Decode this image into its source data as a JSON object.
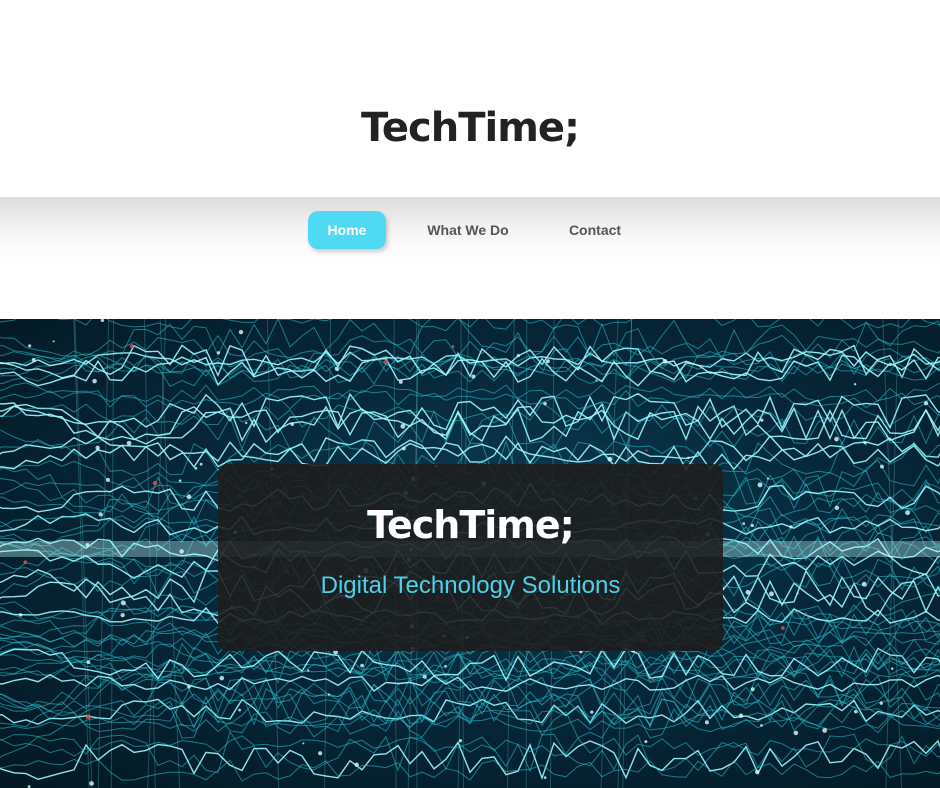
{
  "header": {
    "site_title": "TechTime;"
  },
  "nav": {
    "items": [
      {
        "label": "Home",
        "active": true
      },
      {
        "label": "What We Do",
        "active": false
      },
      {
        "label": "Contact",
        "active": false
      }
    ],
    "active_color": "#4fd9f2"
  },
  "hero": {
    "title": "TechTime;",
    "subtitle": "Digital Technology Solutions",
    "accent_color": "#4fd0e6"
  }
}
